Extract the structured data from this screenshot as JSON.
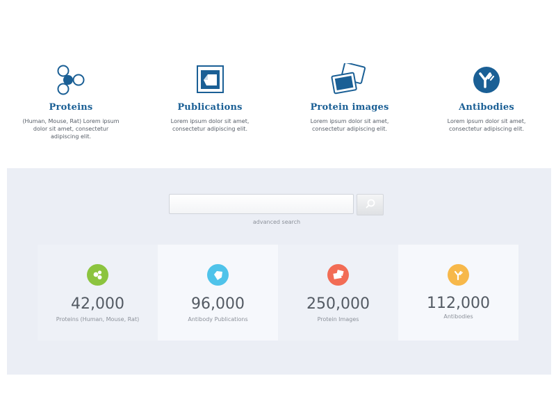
{
  "features": [
    {
      "icon": "molecule-icon",
      "title": "Proteins",
      "desc": "(Human, Mouse, Rat) Lorem ipsum dolor sit amet, consectetur adipiscing elit."
    },
    {
      "icon": "publication-icon",
      "title": "Publications",
      "desc": "Lorem ipsum dolor sit amet, consectetur adipiscing elit."
    },
    {
      "icon": "images-icon",
      "title": "Protein images",
      "desc": "Lorem ipsum dolor sit amet, consectetur adipiscing elit."
    },
    {
      "icon": "antibody-icon",
      "title": "Antibodies",
      "desc": "Lorem ipsum dolor sit amet, consectetur adipiscing elit."
    }
  ],
  "search": {
    "placeholder": "",
    "button_icon": "search-icon",
    "advanced_label": "advanced search"
  },
  "stats": [
    {
      "icon": "molecule-icon",
      "color": "#8cc43f",
      "value": "42,000",
      "label": "Proteins (Human, Mouse, Rat)"
    },
    {
      "icon": "publication-icon",
      "color": "#4fc3ea",
      "value": "96,000",
      "label": "Antibody Publications"
    },
    {
      "icon": "images-icon",
      "color": "#f26c55",
      "value": "250,000",
      "label": "Protein Images"
    },
    {
      "icon": "antibody-icon",
      "color": "#f7b84a",
      "value": "112,000",
      "label": "Antibodies"
    }
  ],
  "colors": {
    "brand_blue": "#1a5f95",
    "band_background": "#ebeef5"
  }
}
